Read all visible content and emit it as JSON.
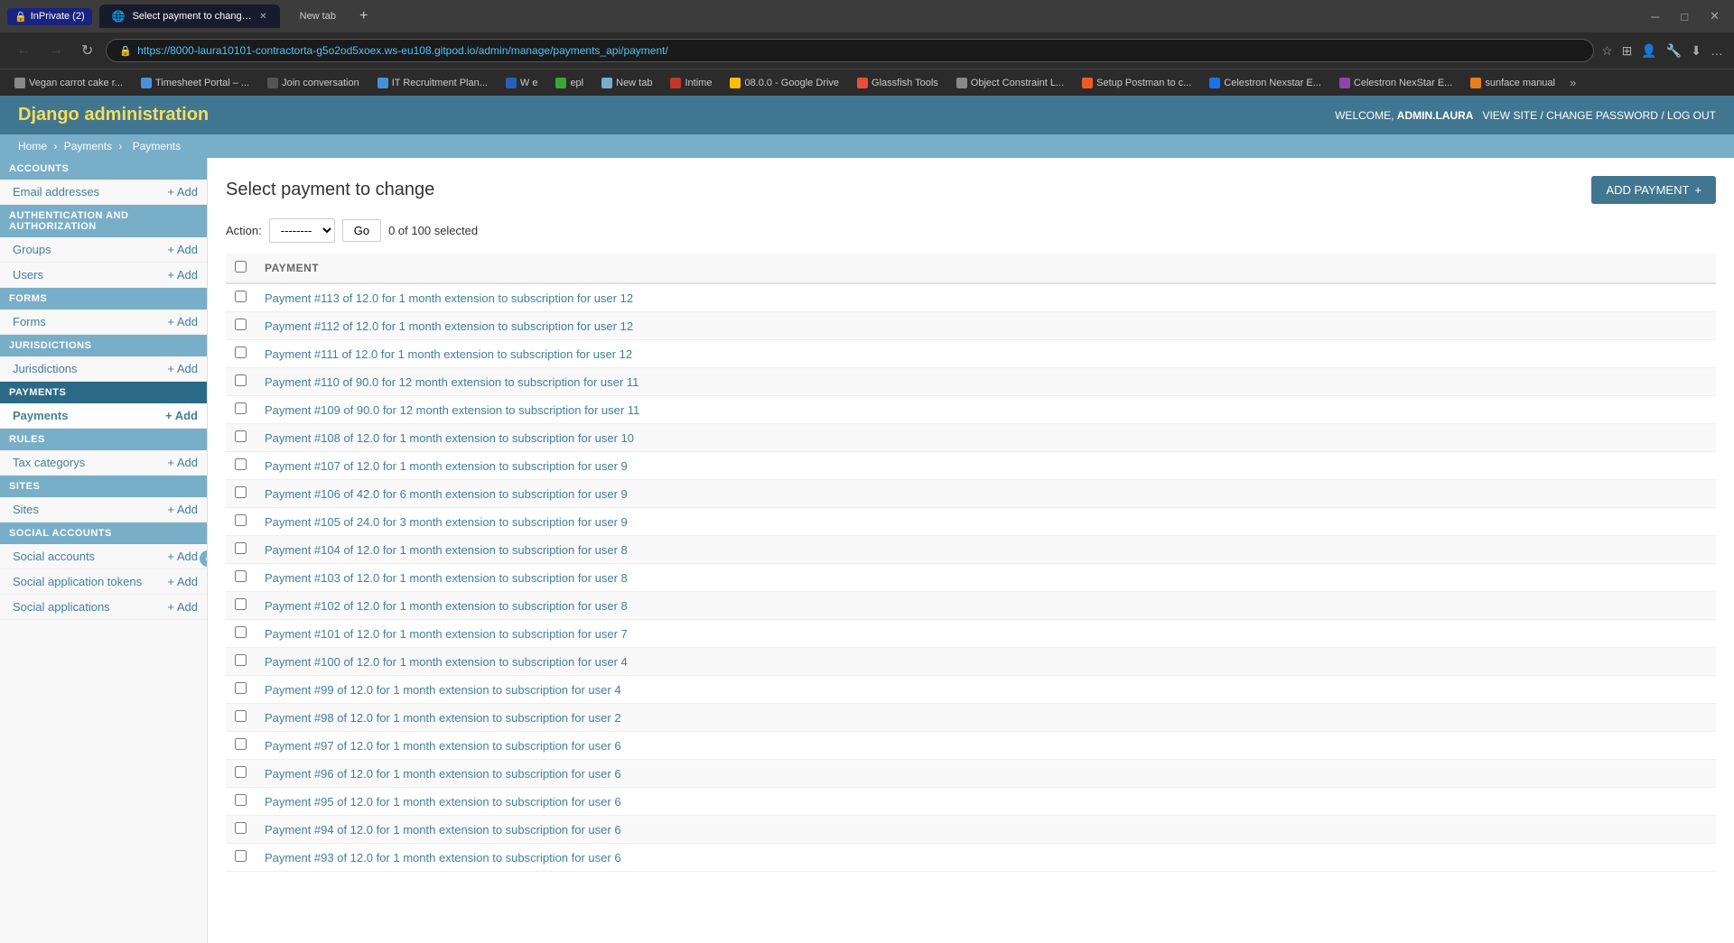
{
  "browser": {
    "tab_active_label": "Select payment to change | Djan",
    "tab_new_label": "New tab",
    "inprivate_label": "InPrivate (2)",
    "url": "https://8000-laura10101-contractorta-g5o2od5xoex.ws-eu108.gitpod.io/admin/manage/payments_api/payment/",
    "bookmarks": [
      {
        "label": "Vegan carrot cake r..."
      },
      {
        "label": "Timesheet Portal – ..."
      },
      {
        "label": "Join conversation"
      },
      {
        "label": "IT Recruitment Plan..."
      },
      {
        "label": "W e"
      },
      {
        "label": "epl"
      },
      {
        "label": "New tab"
      },
      {
        "label": "Intime"
      },
      {
        "label": "08.0.0 - Google Drive"
      },
      {
        "label": "Glassfish Tools"
      },
      {
        "label": "Object Constraint L..."
      },
      {
        "label": "Setup Postman to c..."
      },
      {
        "label": "Celestron Nexstar E..."
      },
      {
        "label": "Celestron NexStar E..."
      },
      {
        "label": "sunface manual"
      }
    ]
  },
  "django": {
    "app_title": "Django administration",
    "welcome_text": "WELCOME,",
    "username": "ADMIN.LAURA",
    "view_site": "VIEW SITE",
    "change_password": "CHANGE PASSWORD",
    "log_out": "LOG OUT"
  },
  "breadcrumb": {
    "home": "Home",
    "section": "Payments",
    "current": "Payments"
  },
  "sidebar": {
    "sections": [
      {
        "id": "accounts",
        "label": "ACCOUNTS",
        "items": [
          {
            "label": "Email addresses",
            "add": true
          }
        ]
      },
      {
        "id": "auth",
        "label": "AUTHENTICATION AND AUTHORIZATION",
        "items": [
          {
            "label": "Groups",
            "add": true
          },
          {
            "label": "Users",
            "add": true
          }
        ]
      },
      {
        "id": "forms",
        "label": "FORMS",
        "items": [
          {
            "label": "Forms",
            "add": true
          }
        ]
      },
      {
        "id": "jurisdictions",
        "label": "JURISDICTIONS",
        "items": [
          {
            "label": "Jurisdictions",
            "add": true
          }
        ]
      },
      {
        "id": "payments",
        "label": "PAYMENTS",
        "items": [
          {
            "label": "Payments",
            "add": true,
            "active": true
          }
        ]
      },
      {
        "id": "rules",
        "label": "RULES",
        "items": [
          {
            "label": "Tax categorys",
            "add": true
          }
        ]
      },
      {
        "id": "sites",
        "label": "SITES",
        "items": [
          {
            "label": "Sites",
            "add": true
          }
        ]
      },
      {
        "id": "social_accounts",
        "label": "SOCIAL ACCOUNTS",
        "items": [
          {
            "label": "Social accounts",
            "add": true
          },
          {
            "label": "Social application tokens",
            "add": true
          },
          {
            "label": "Social applications",
            "add": true
          }
        ]
      }
    ]
  },
  "content": {
    "title": "Select payment to change",
    "add_button": "ADD PAYMENT",
    "action_label": "Action:",
    "action_placeholder": "--------",
    "go_button": "Go",
    "selection_text": "0 of 100 selected",
    "table_header": "PAYMENT",
    "payments": [
      {
        "label": "Payment #113 of 12.0 for 1 month extension to subscription for user 12"
      },
      {
        "label": "Payment #112 of 12.0 for 1 month extension to subscription for user 12"
      },
      {
        "label": "Payment #111 of 12.0 for 1 month extension to subscription for user 12"
      },
      {
        "label": "Payment #110 of 90.0 for 12 month extension to subscription for user 11"
      },
      {
        "label": "Payment #109 of 90.0 for 12 month extension to subscription for user 11"
      },
      {
        "label": "Payment #108 of 12.0 for 1 month extension to subscription for user 10"
      },
      {
        "label": "Payment #107 of 12.0 for 1 month extension to subscription for user 9"
      },
      {
        "label": "Payment #106 of 42.0 for 6 month extension to subscription for user 9"
      },
      {
        "label": "Payment #105 of 24.0 for 3 month extension to subscription for user 9"
      },
      {
        "label": "Payment #104 of 12.0 for 1 month extension to subscription for user 8"
      },
      {
        "label": "Payment #103 of 12.0 for 1 month extension to subscription for user 8"
      },
      {
        "label": "Payment #102 of 12.0 for 1 month extension to subscription for user 8"
      },
      {
        "label": "Payment #101 of 12.0 for 1 month extension to subscription for user 7"
      },
      {
        "label": "Payment #100 of 12.0 for 1 month extension to subscription for user 4"
      },
      {
        "label": "Payment #99 of 12.0 for 1 month extension to subscription for user 4"
      },
      {
        "label": "Payment #98 of 12.0 for 1 month extension to subscription for user 2"
      },
      {
        "label": "Payment #97 of 12.0 for 1 month extension to subscription for user 6"
      },
      {
        "label": "Payment #96 of 12.0 for 1 month extension to subscription for user 6"
      },
      {
        "label": "Payment #95 of 12.0 for 1 month extension to subscription for user 6"
      },
      {
        "label": "Payment #94 of 12.0 for 1 month extension to subscription for user 6"
      },
      {
        "label": "Payment #93 of 12.0 for 1 month extension to subscription for user 6"
      }
    ]
  }
}
